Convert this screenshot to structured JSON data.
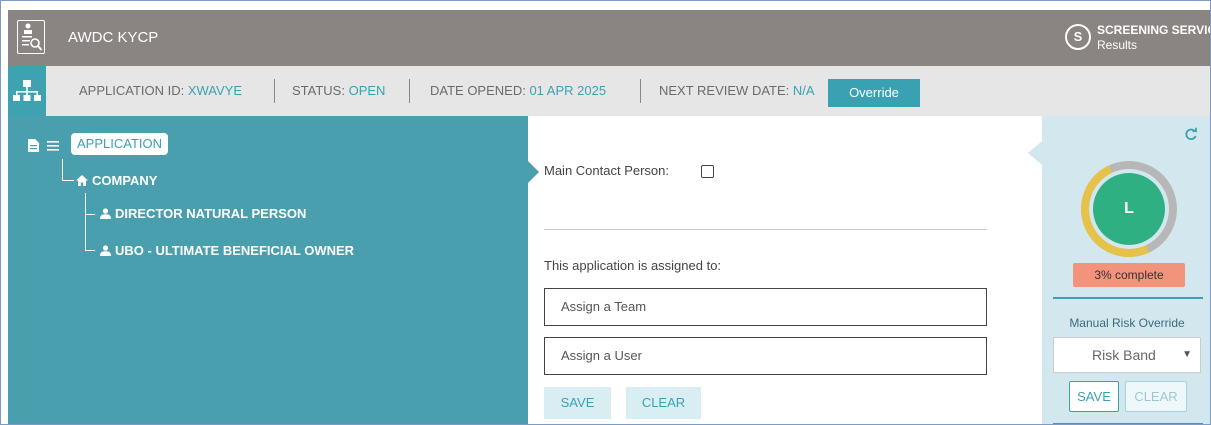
{
  "header": {
    "app_title": "AWDC KYCP",
    "service_title": "SCREENING SERVIC",
    "service_subtitle": "Results",
    "logo_icon": "document-search-icon",
    "service_icon": "screening-s-icon"
  },
  "infobar": {
    "tree_icon": "org-tree-icon",
    "application_id_label": "APPLICATION ID: ",
    "application_id_value": "XWAVYE",
    "status_label": "STATUS: ",
    "status_value": "OPEN",
    "date_opened_label": "DATE OPENED: ",
    "date_opened_value": "01 APR 2025",
    "next_review_label": "NEXT REVIEW DATE: ",
    "next_review_value": "N/A",
    "override_label": "Override"
  },
  "tree": {
    "root_label": "APPLICATION",
    "company_label": "COMPANY",
    "children": [
      {
        "label": "DIRECTOR NATURAL PERSON"
      },
      {
        "label": "UBO - ULTIMATE BENEFICIAL OWNER"
      }
    ]
  },
  "form": {
    "main_contact_label": "Main Contact Person:",
    "main_contact_checked": false,
    "assigned_label": "This application is assigned to:",
    "team_placeholder": "Assign a Team",
    "user_placeholder": "Assign a User",
    "save_label": "SAVE",
    "clear_label": "CLEAR"
  },
  "risk": {
    "grade": "L",
    "completion_text": "3% complete",
    "completion_fraction": 0.03,
    "manual_override_label": "Manual Risk Override",
    "risk_band_placeholder": "Risk Band",
    "save_label": "SAVE",
    "clear_label": "CLEAR",
    "colors": {
      "teal": "#3aa1b3",
      "grade_green": "#2fb083",
      "ring_gold": "#e6c24a",
      "badge_salmon": "#f4937c"
    }
  }
}
